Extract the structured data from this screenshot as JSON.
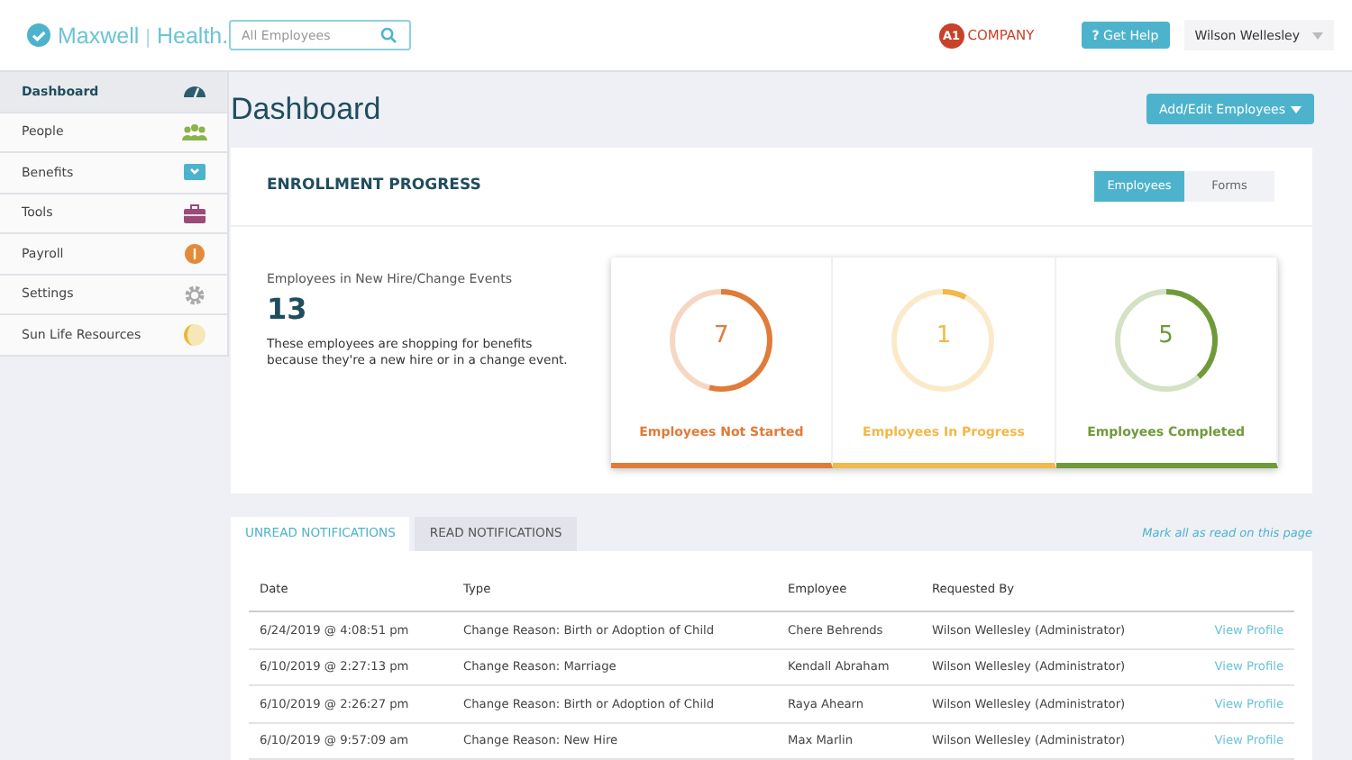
{
  "header": {
    "logo": {
      "brand": "Maxwell",
      "divider": "|",
      "product": "Health."
    },
    "search": {
      "placeholder": "All Employees"
    },
    "company": {
      "badge": "A1",
      "name": "COMPANY"
    },
    "help_button": {
      "icon": "?",
      "label": "Get Help"
    },
    "user_menu": {
      "label": "Wilson Wellesley"
    }
  },
  "sidebar": {
    "items": [
      {
        "label": "Dashboard",
        "selected": true
      },
      {
        "label": "People",
        "selected": false
      },
      {
        "label": "Benefits",
        "selected": false
      },
      {
        "label": "Tools",
        "selected": false
      },
      {
        "label": "Payroll",
        "selected": false
      },
      {
        "label": "Settings",
        "selected": false
      },
      {
        "label": "Sun Life Resources",
        "selected": false
      }
    ]
  },
  "page": {
    "title": "Dashboard",
    "action_button": "Add/Edit Employees"
  },
  "enrollment": {
    "title": "ENROLLMENT PROGRESS",
    "toggle": [
      {
        "label": "Employees",
        "selected": true
      },
      {
        "label": "Forms",
        "selected": false
      }
    ],
    "summary": {
      "label": "Employees in New Hire/Change Events",
      "count": "13",
      "description": "These employees are shopping for benefits because they're a new hire or in a change event."
    },
    "stats": [
      {
        "value": "7",
        "label": "Employees Not Started",
        "color": "#e07b39"
      },
      {
        "value": "1",
        "label": "Employees In Progress",
        "color": "#f2b84b"
      },
      {
        "value": "5",
        "label": "Employees Completed",
        "color": "#6f9a3a"
      }
    ]
  },
  "notifications": {
    "tabs": [
      {
        "label": "UNREAD NOTIFICATIONS",
        "selected": true
      },
      {
        "label": "READ NOTIFICATIONS",
        "selected": false
      }
    ],
    "mark_all": "Mark all as read on this page",
    "columns": [
      "Date",
      "Type",
      "Employee",
      "Requested By"
    ],
    "rows": [
      {
        "date": "6/24/2019 @ 4:08:51 pm",
        "type": "Change Reason: Birth or Adoption of Child",
        "employee": "Chere Behrends",
        "requested_by": "Wilson Wellesley (Administrator)",
        "action": "View Profile"
      },
      {
        "date": "6/10/2019 @ 2:27:13 pm",
        "type": "Change Reason: Marriage",
        "employee": "Kendall Abraham",
        "requested_by": "Wilson Wellesley (Administrator)",
        "action": "View Profile"
      },
      {
        "date": "6/10/2019 @ 2:26:27 pm",
        "type": "Change Reason: Birth or Adoption of Child",
        "employee": "Raya Ahearn",
        "requested_by": "Wilson Wellesley (Administrator)",
        "action": "View Profile"
      },
      {
        "date": "6/10/2019 @ 9:57:09 am",
        "type": "Change Reason: New Hire",
        "employee": "Max Marlin",
        "requested_by": "Wilson Wellesley (Administrator)",
        "action": "View Profile"
      }
    ]
  }
}
